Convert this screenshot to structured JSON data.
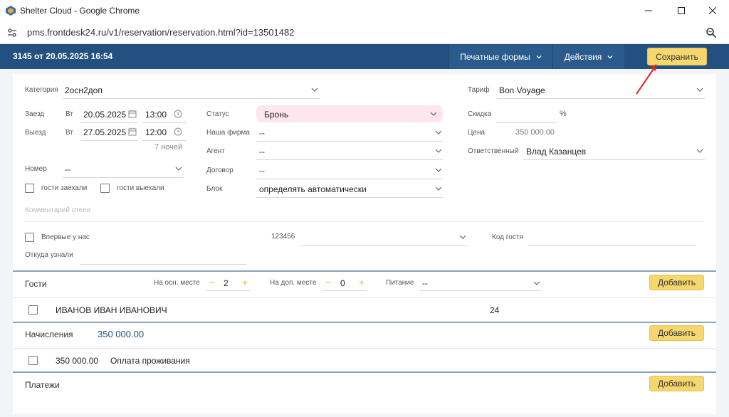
{
  "window": {
    "title": "Shelter Cloud - Google Chrome",
    "url": "pms.frontdesk24.ru/v1/reservation/reservation.html?id=13501482"
  },
  "header": {
    "title": "3145 от 20.05.2025 16:54",
    "print_forms": "Печатные формы",
    "actions": "Действия",
    "save": "Сохранить"
  },
  "form": {
    "category_label": "Категория",
    "category_value": "2осн2доп",
    "checkin_label": "Заезд",
    "checkin_day": "Вт",
    "checkin_date": "20.05.2025",
    "checkin_time": "13:00",
    "checkout_label": "Выезд",
    "checkout_day": "Вт",
    "checkout_date": "27.05.2025",
    "checkout_time": "12:00",
    "nights": "7 ночей",
    "room_label": "Номер",
    "room_value": "--",
    "guests_arrived": "гости заехали",
    "guests_left": "гости выехали",
    "status_label": "Статус",
    "status_value": "Бронь",
    "firm_label": "Наша фирма",
    "firm_value": "--",
    "agent_label": "Агент",
    "agent_value": "--",
    "contract_label": "Договор",
    "contract_value": "--",
    "block_label": "Блок",
    "block_value": "определять автоматически",
    "tariff_label": "Тариф",
    "tariff_value": "Bon Voyage",
    "discount_label": "Скидка",
    "discount_unit": "%",
    "price_label": "Цена",
    "price_value": "350 000.00",
    "responsible_label": "Ответственный",
    "responsible_value": "Влад Казанцев",
    "hotel_comment_placeholder": "Комментарий отеля",
    "first_time": "Впервые у нас",
    "guest_select_value": "123456",
    "guest_code_label": "Код гостя",
    "source_label": "Откуда узнали"
  },
  "guests": {
    "title": "Гости",
    "main_place_label": "На осн. месте",
    "main_place_count": "2",
    "extra_place_label": "На доп. месте",
    "extra_place_count": "0",
    "meal_label": "Питание",
    "meal_value": "--",
    "add": "Добавить",
    "rows": [
      {
        "name": "ИВАНОВ ИВАН ИВАНОВИЧ",
        "age": "24"
      }
    ]
  },
  "charges": {
    "title": "Начисления",
    "total": "350 000.00",
    "add": "Добавить",
    "rows": [
      {
        "amount": "350 000.00",
        "description": "Оплата проживания"
      }
    ]
  },
  "payments": {
    "title": "Платежи",
    "add": "Добавить"
  },
  "colors": {
    "header_bg": "#23507e",
    "accent_button": "#f5d76e",
    "status_bg": "#fde6ef",
    "arrow": "#e0241b"
  }
}
